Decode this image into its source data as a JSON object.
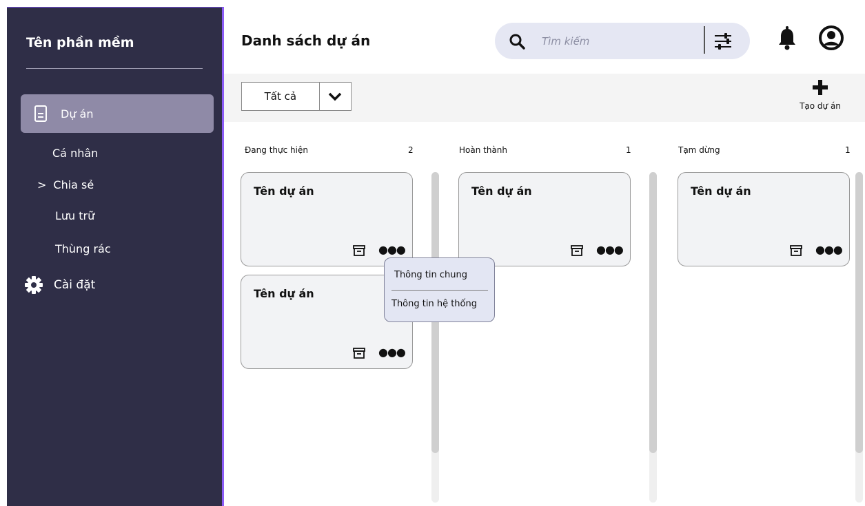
{
  "sidebar": {
    "app_name": "Tên phần mềm",
    "active_item": "Dự án",
    "sub_items": [
      {
        "label": "Cá nhân",
        "chevron": ""
      },
      {
        "label": "Chia sẻ",
        "chevron": ">"
      },
      {
        "label": "Lưu trữ",
        "chevron": ""
      },
      {
        "label": "Thùng rác",
        "chevron": ""
      }
    ],
    "settings_label": "Cài đặt"
  },
  "header": {
    "title": "Danh sách dự án",
    "search_placeholder": "Tìm kiếm"
  },
  "toolbar": {
    "filter_value": "Tất cả",
    "create_label": "Tạo dự án"
  },
  "columns": [
    {
      "name": "Đang thực hiện",
      "count": "2",
      "cards": [
        {
          "title": "Tên dự án"
        },
        {
          "title": "Tên dự án"
        }
      ]
    },
    {
      "name": "Hoàn thành",
      "count": "1",
      "cards": [
        {
          "title": "Tên dự án"
        }
      ]
    },
    {
      "name": "Tạm dừng",
      "count": "1",
      "cards": [
        {
          "title": "Tên dự án"
        }
      ]
    }
  ],
  "context_menu": {
    "items": [
      "Thông tin chung",
      "Thông tin hệ thống"
    ]
  },
  "colors": {
    "sidebar_bg": "#2f2e47",
    "sidebar_active": "#8f8aa7",
    "accent_border": "#8b5cf6",
    "search_bg": "#e5e7f3"
  }
}
